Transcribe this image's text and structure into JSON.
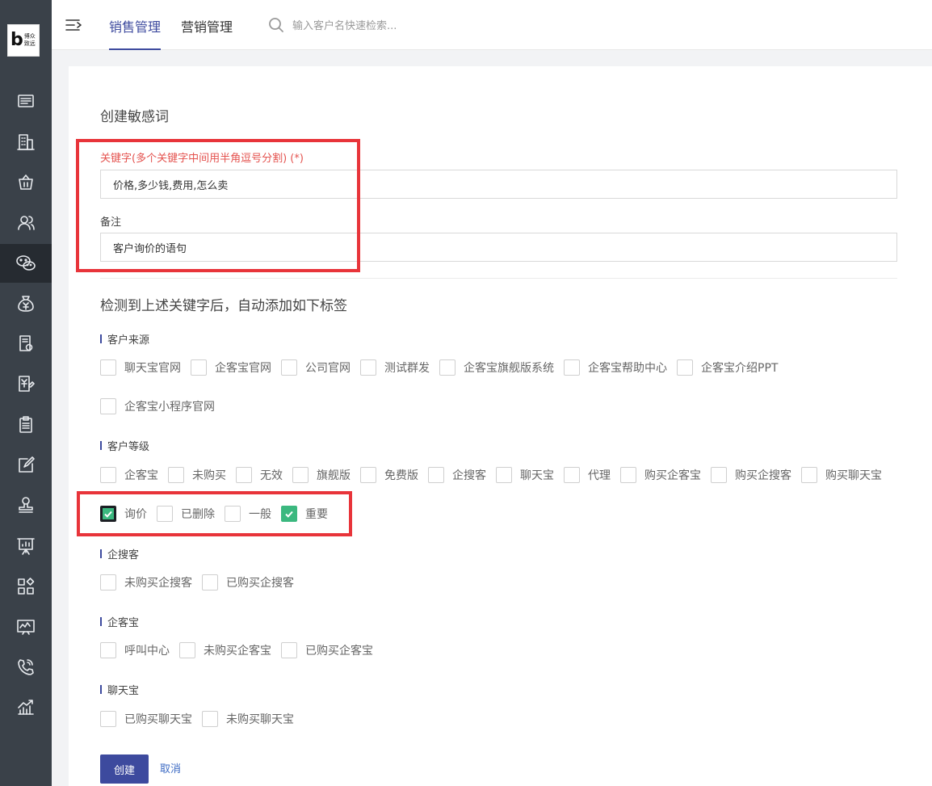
{
  "logo": {
    "letter": "b",
    "line1": "博众",
    "line2": "致远"
  },
  "header": {
    "tabs": [
      {
        "label": "销售管理",
        "active": true
      },
      {
        "label": "营销管理",
        "active": false
      }
    ],
    "search_placeholder": "输入客户名快速检索..."
  },
  "sidebar": {
    "icons": [
      "screen-icon",
      "building-icon",
      "basket-icon",
      "users-icon",
      "wechat-icon",
      "money-bag-icon",
      "certificate-icon",
      "invoice-edit-icon",
      "clipboard-icon",
      "edit-icon",
      "stamp-icon",
      "presentation-icon",
      "apps-icon",
      "analytics-icon",
      "phone-icon",
      "chart-up-icon"
    ],
    "active_index": 4
  },
  "form": {
    "title": "创建敏感词",
    "keyword_label": "关键字(多个关键字中间用半角逗号分割) (*)",
    "keyword_value": "价格,多少钱,费用,怎么卖",
    "note_label": "备注",
    "note_value": "客户询价的语句",
    "section_title": "检测到上述关键字后，自动添加如下标签",
    "groups": [
      {
        "title": "客户来源",
        "rows": [
          [
            "聊天宝官网",
            "企客宝官网",
            "公司官网",
            "测试群发",
            "企客宝旗舰版系统",
            "企客宝帮助中心",
            "企客宝介绍PPT"
          ],
          [
            "企客宝小程序官网"
          ]
        ]
      },
      {
        "title": "客户等级",
        "rows": [
          [
            "企客宝",
            "未购买",
            "无效",
            "旗舰版",
            "免费版",
            "企搜客",
            "聊天宝",
            "代理",
            "购买企客宝",
            "购买企搜客",
            "购买聊天宝"
          ],
          [
            "询价",
            "已删除",
            "一般",
            "重要"
          ]
        ]
      },
      {
        "title": "企搜客",
        "rows": [
          [
            "未购买企搜客",
            "已购买企搜客"
          ]
        ]
      },
      {
        "title": "企客宝",
        "rows": [
          [
            "呼叫中心",
            "未购买企客宝",
            "已购买企客宝"
          ]
        ]
      },
      {
        "title": "聊天宝",
        "rows": [
          [
            "已购买聊天宝",
            "未购买聊天宝"
          ]
        ]
      }
    ],
    "checked": [
      "询价",
      "重要"
    ],
    "create_label": "创建",
    "cancel_label": "取消"
  },
  "colors": {
    "primary": "#3d4a9e",
    "check": "#3bb87f",
    "highlight": "#e8343a",
    "required": "#e4534f"
  }
}
